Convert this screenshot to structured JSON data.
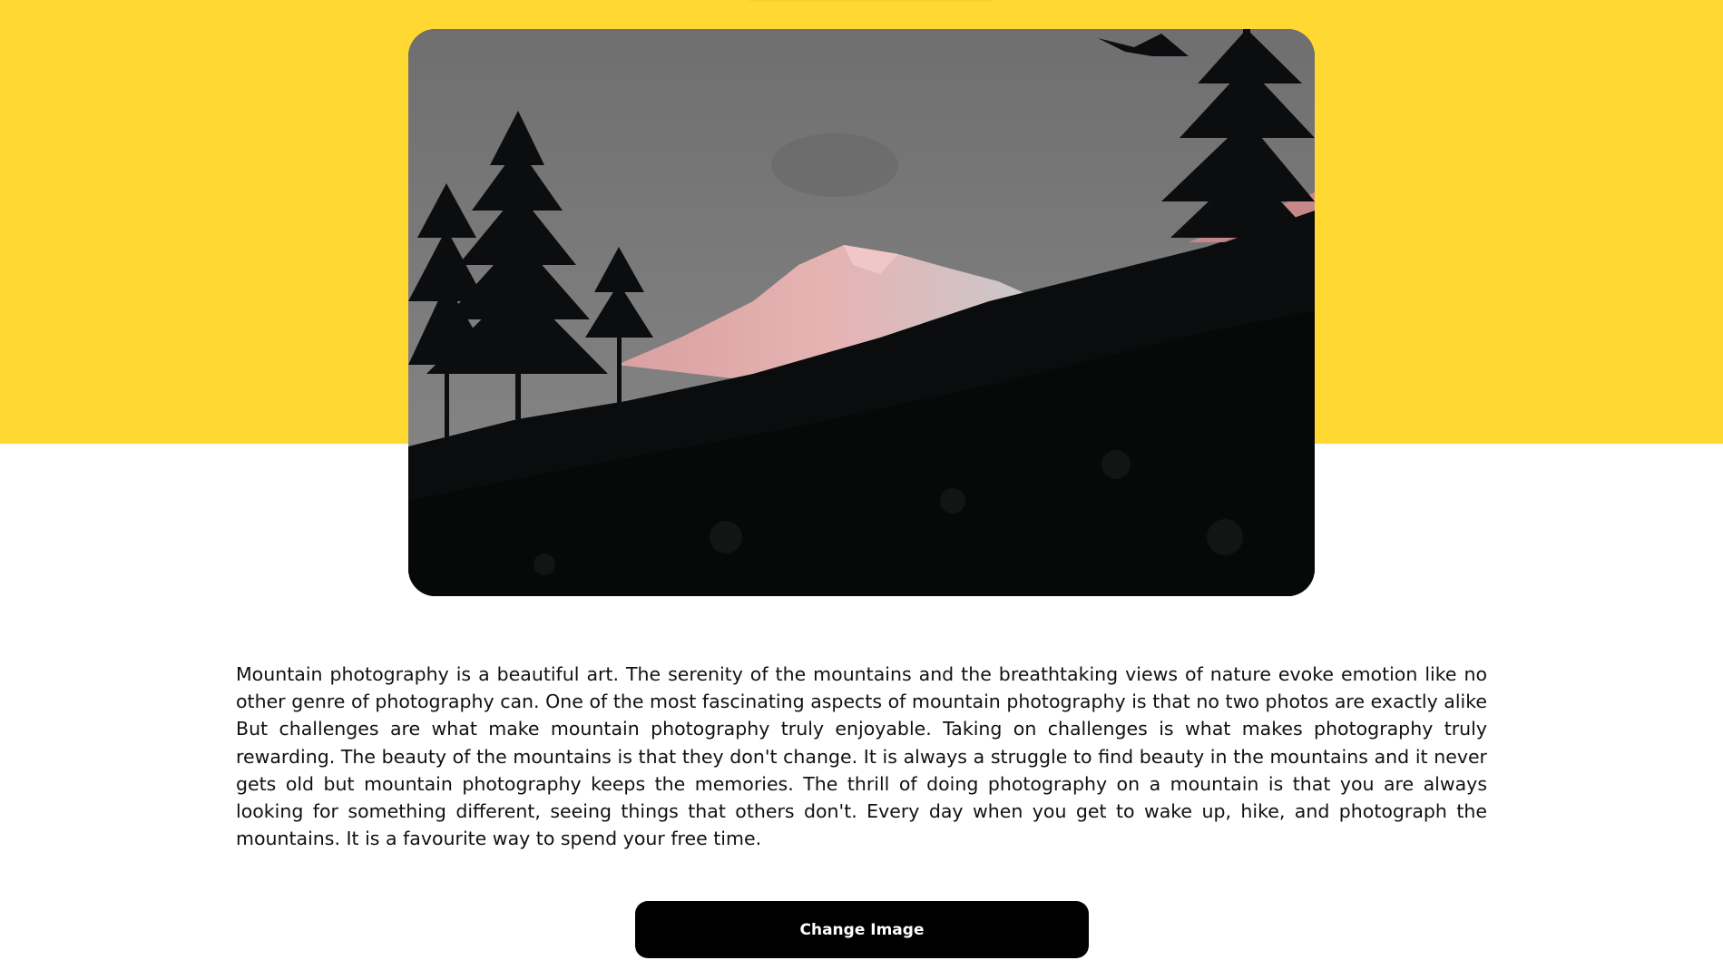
{
  "description": "Mountain photography is a beautiful art. The serenity of the mountains and the breathtaking views of nature evoke emotion like no other genre of photography can. One of the most fascinating aspects of mountain photography is that no two photos are exactly alike But challenges are what make mountain photography truly enjoyable. Taking on challenges is what makes photography truly rewarding. The beauty of the mountains is that they don't change. It is always a struggle to find beauty in the mountains and it never gets old but mountain photography keeps the memories. The thrill of doing photography on a mountain is that you are always looking for something different, seeing things that others don't. Every day when you get to wake up, hike, and photograph the mountains. It is a favourite way to spend your free time.",
  "change_button_label": "Change Image",
  "colors": {
    "accent_background": "#ffd932",
    "button_background": "#000000",
    "button_text": "#ffffff"
  },
  "image": {
    "subject": "mountain-photo"
  }
}
